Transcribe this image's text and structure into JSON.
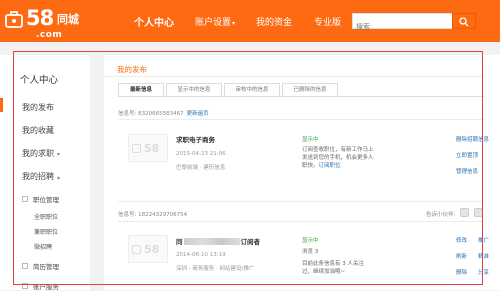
{
  "brand": {
    "num": "58",
    "cn": "同城",
    "domain": ".com"
  },
  "nav": {
    "items": [
      {
        "label": "个人中心",
        "active": true
      },
      {
        "label": "账户设置",
        "dropdown": true
      },
      {
        "label": "我的资金"
      },
      {
        "label": "专业版"
      }
    ]
  },
  "search": {
    "placeholder": "搜索"
  },
  "sidebar": {
    "title": "个人中心",
    "items": [
      {
        "label": "我的发布"
      },
      {
        "label": "我的收藏"
      },
      {
        "label": "我的求职"
      },
      {
        "label": "我的招聘"
      }
    ],
    "sub1": {
      "label": "职位管理"
    },
    "sub1_items": [
      "全职职位",
      "兼职职位",
      "微招聘"
    ],
    "sub2": {
      "label": "简历管理"
    },
    "sub3": {
      "label": "账户服务"
    }
  },
  "main": {
    "title": "我的发布",
    "tabs": [
      "最新信息",
      "显示中的信息",
      "审核中的信息",
      "已删除的信息"
    ],
    "posts": [
      {
        "info_id": "信息号: 8320665583467",
        "info_link": "更新遍页",
        "title": "求职电子商务",
        "date": "2015-04-23 21:06",
        "meta": "巴黎前端 · 建历信息",
        "status": "显示中",
        "note_text": "订阅查收职位，有新工作马上发送到您的手机，机会更多人职快。",
        "note_link": "订阅职位",
        "actions": [
          "删除招聘信息",
          "立即置顶",
          "管理信息"
        ]
      },
      {
        "info_id": "信息号: 18224329706754",
        "small_link": "告诉小伙伴:",
        "title_prefix": "同",
        "title_suffix": "订阅者",
        "date": "2014-06-10 13:19",
        "meta": "深圳 · 商务服务 · 网站建设/推广",
        "status": "显示中",
        "note_text": "浏览 3",
        "note_text2": "目前此条信息有 3 人关注过，继续加油哦~",
        "actions": [
          "修改",
          "刷新",
          "删除"
        ],
        "actions2": [
          "推广",
          "精准",
          "分享"
        ]
      }
    ]
  }
}
